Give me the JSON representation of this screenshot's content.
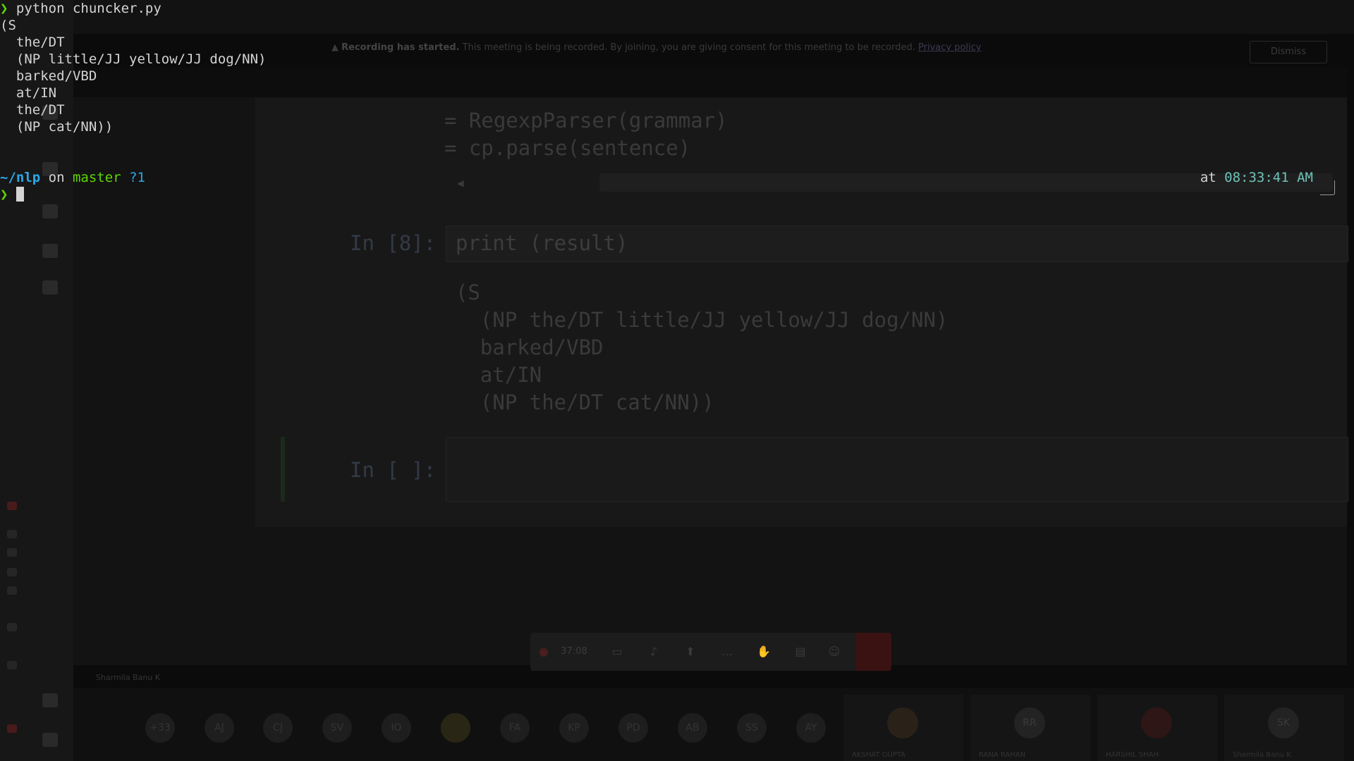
{
  "terminal": {
    "prompt_symbol": "❯",
    "command": "python chuncker.py",
    "output": [
      "(S",
      "  the/DT",
      "  (NP little/JJ yellow/JJ dog/NN)",
      "  barked/VBD",
      "  at/IN",
      "  the/DT",
      "  (NP cat/NN))"
    ],
    "cwd_prefix": "~/",
    "cwd": "nlp",
    "on_word": " on ",
    "branch": "master",
    "git_status": " ?1",
    "at_word": "at ",
    "time": "08:33:41 AM"
  },
  "meeting": {
    "banner_title": "Recording has started.",
    "banner_text": "This meeting is being recorded. By joining, you are giving consent for this meeting to be recorded.",
    "banner_link": "Privacy policy",
    "dismiss_label": "Dismiss",
    "timer": "37:08",
    "presenter_label": "Sharmila Banu K",
    "notebook": {
      "code_lines": [
        "= RegexpParser(grammar)",
        "= cp.parse(sentence)"
      ],
      "cell8_prompt": "In [8]:",
      "cell8_code": "print (result)",
      "cell8_output": [
        "(S",
        "  (NP the/DT little/JJ yellow/JJ dog/NN)",
        "  barked/VBD",
        "  at/IN",
        "  (NP the/DT cat/NN))"
      ],
      "empty_prompt": "In [ ]:"
    },
    "participants": [
      "+33",
      "AJ",
      "CJ",
      "SV",
      "IO",
      "",
      "FA",
      "KP",
      "PD",
      "AB",
      "SS",
      "AY"
    ],
    "tiles": [
      {
        "name": "AKSHAT GUPTA",
        "initials": ""
      },
      {
        "name": "RANA RAHAN",
        "initials": "RR"
      },
      {
        "name": "HARSHIL SHAH",
        "initials": ""
      },
      {
        "name": "Sharmila Banu K",
        "initials": "SK"
      }
    ]
  }
}
